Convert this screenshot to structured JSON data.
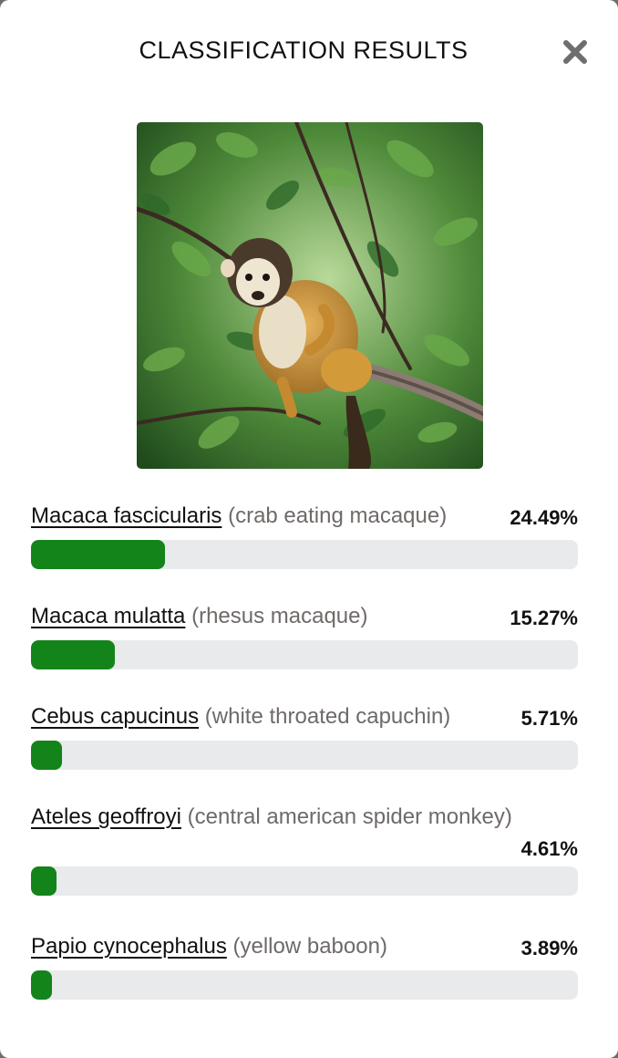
{
  "modal": {
    "title": "CLASSIFICATION RESULTS",
    "close_icon": "close-icon"
  },
  "image": {
    "subject_icon": "monkey-photo"
  },
  "colors": {
    "bar_fill": "#13841a",
    "bar_track": "#e8eaec",
    "common_name": "#6e6a68"
  },
  "results": [
    {
      "scientific_name": "Macaca fascicularis",
      "common_name": "(crab eating macaque)",
      "percent_label": "24.49%",
      "value": 24.49
    },
    {
      "scientific_name": "Macaca mulatta",
      "common_name": "(rhesus macaque)",
      "percent_label": "15.27%",
      "value": 15.27
    },
    {
      "scientific_name": "Cebus capucinus",
      "common_name": "(white throated capuchin)",
      "percent_label": "5.71%",
      "value": 5.71
    },
    {
      "scientific_name": "Ateles geoffroyi",
      "common_name": "(central american spider monkey)",
      "percent_label": "4.61%",
      "value": 4.61
    },
    {
      "scientific_name": "Papio cynocephalus",
      "common_name": "(yellow baboon)",
      "percent_label": "3.89%",
      "value": 3.89
    }
  ]
}
